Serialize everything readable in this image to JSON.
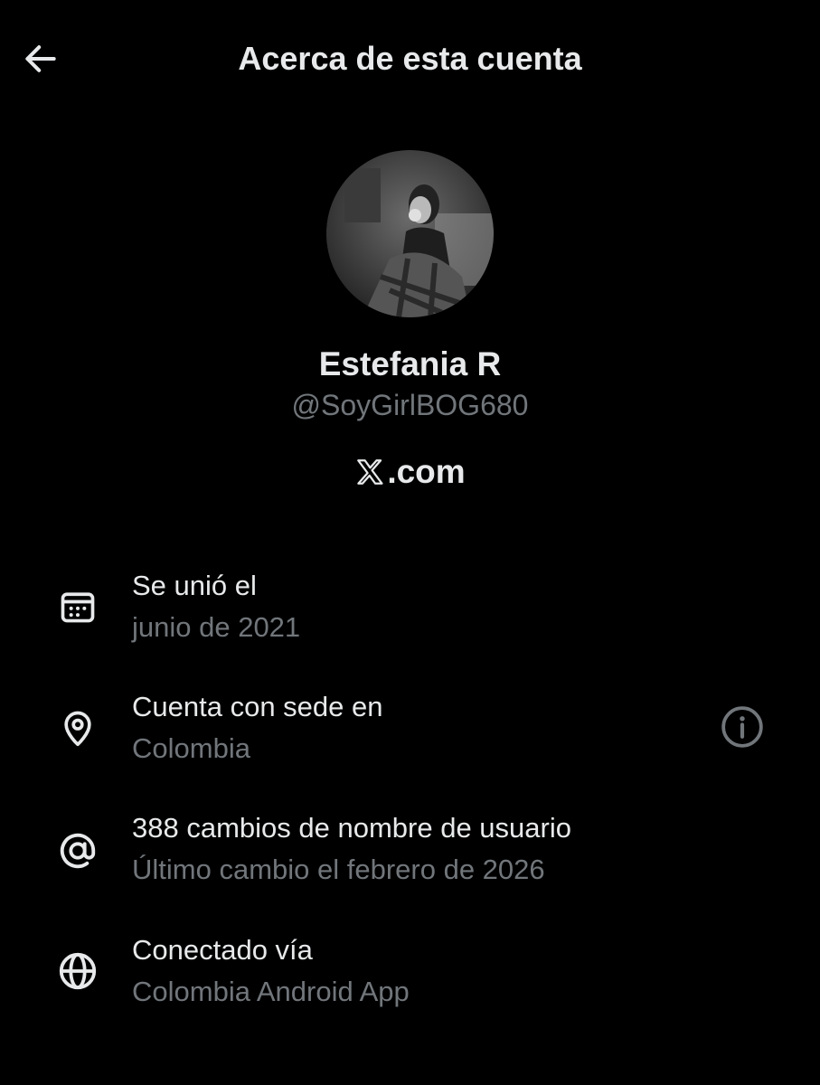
{
  "header": {
    "title": "Acerca de esta cuenta",
    "back_icon": "arrow-left-icon"
  },
  "profile": {
    "display_name": "Estefania R",
    "handle": "@SoyGirlBOG680",
    "platform": ".com",
    "platform_logo": "x-logo-icon"
  },
  "details": [
    {
      "icon": "calendar-icon",
      "label": "Se unió el",
      "value": "junio de 2021"
    },
    {
      "icon": "location-pin-icon",
      "label": "Cuenta con sede en",
      "value": "Colombia",
      "action_icon": "info-icon"
    },
    {
      "icon": "at-sign-icon",
      "label": "388 cambios de nombre de usuario",
      "value": "Último cambio el febrero de 2026"
    },
    {
      "icon": "globe-icon",
      "label": "Conectado vía",
      "value": "Colombia Android App"
    }
  ],
  "colors": {
    "background": "#000000",
    "primary_text": "#e7e9ea",
    "secondary_text": "#71767b"
  }
}
